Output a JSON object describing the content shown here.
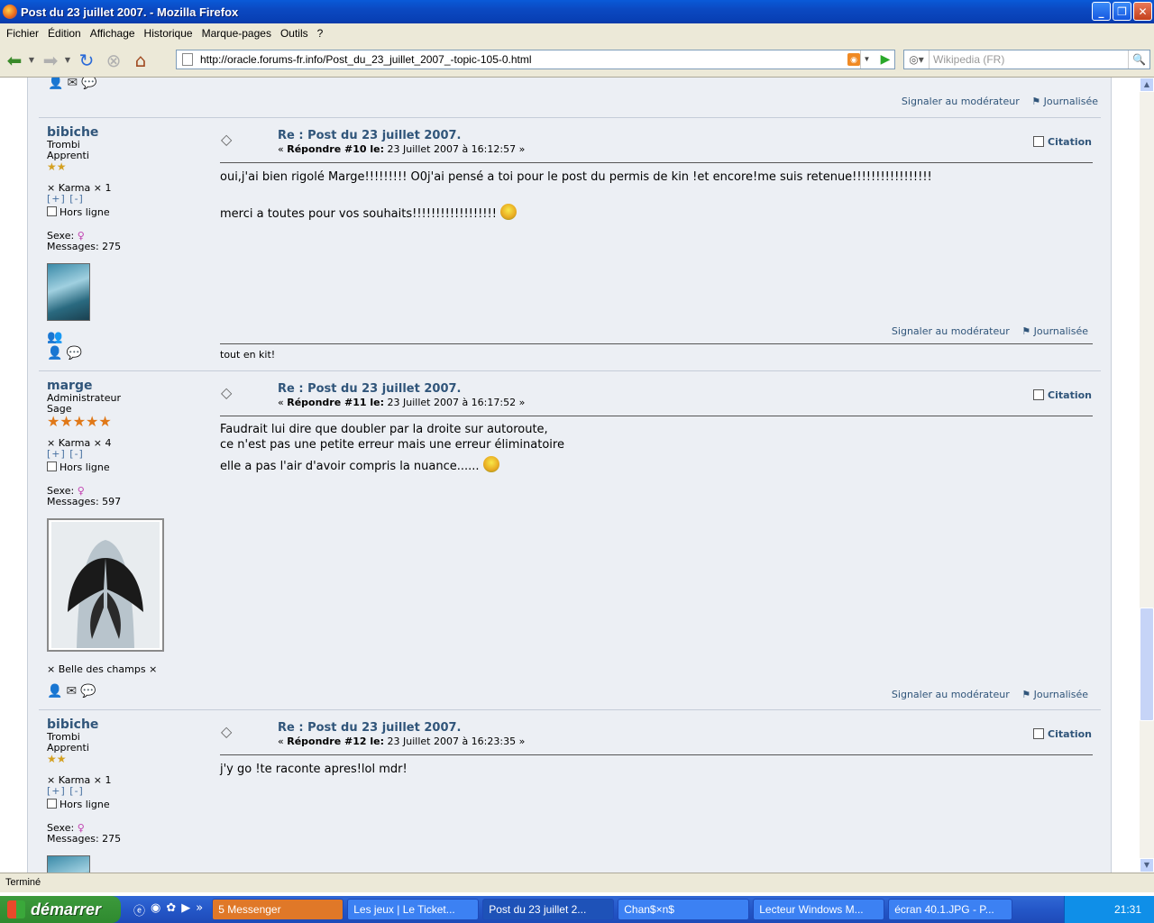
{
  "window": {
    "title": "Post du 23 juillet 2007. - Mozilla Firefox"
  },
  "menu": [
    "Fichier",
    "Édition",
    "Affichage",
    "Historique",
    "Marque-pages",
    "Outils",
    "?"
  ],
  "nav": {
    "url": "http://oracle.forums-fr.info/Post_du_23_juillet_2007_-topic-105-0.html",
    "search_placeholder": "Wikipedia (FR)"
  },
  "common": {
    "report": "Signaler au modérateur",
    "logged": "Journalisée",
    "citation": "Citation",
    "subject": "Re : Post du 23 juillet 2007.",
    "karma_links": "[+] [-]",
    "offline": "Hors ligne"
  },
  "posts": [
    {
      "author": "bibiche",
      "group": "Trombi",
      "rank": "Apprenti",
      "stars": "★★",
      "karma": "× Karma × 1",
      "sex": "Sexe:",
      "messages": "Messages: 275",
      "reply_label": "Répondre #10 le:",
      "date": "23 Juillet 2007 à 16:12:57",
      "lines": [
        "oui,j'ai bien rigolé Marge!!!!!!!!! O0j'ai pensé a toi pour le post du permis de kin !et encore!me suis retenue!!!!!!!!!!!!!!!!!",
        "",
        "merci a toutes pour vos souhaits!!!!!!!!!!!!!!!!!!"
      ],
      "signature": "tout en kit!"
    },
    {
      "author": "marge",
      "group": "Administrateur",
      "rank": "Sage",
      "stars": "★★★★★",
      "karma": "× Karma × 4",
      "sex": "Sexe:",
      "messages": "Messages: 597",
      "reply_label": "Répondre #11 le:",
      "date": "23 Juillet 2007 à 16:17:52",
      "lines": [
        "Faudrait lui dire que doubler par la droite sur autoroute,",
        "ce n'est pas une petite erreur mais une erreur éliminatoire",
        "elle a pas l'air d'avoir compris la nuance......"
      ],
      "personal_text": "× Belle des champs ×"
    },
    {
      "author": "bibiche",
      "group": "Trombi",
      "rank": "Apprenti",
      "stars": "★★",
      "karma": "× Karma × 1",
      "sex": "Sexe:",
      "messages": "Messages: 275",
      "reply_label": "Répondre #12 le:",
      "date": "23 Juillet 2007 à 16:23:35",
      "lines": [
        "j'y go !te raconte apres!lol mdr!"
      ]
    }
  ],
  "status": "Terminé",
  "taskbar": {
    "start": "démarrer",
    "tasks": [
      "5 Messenger",
      "Les jeux | Le Ticket...",
      "Post du 23 juillet 2...",
      "Chan$×n$",
      "Lecteur Windows M...",
      "écran 40.1.JPG - P..."
    ],
    "clock": "21:31"
  },
  "colors": {
    "title_blue": "#0b49c1",
    "link_blue": "#30557a",
    "forum_bg": "#eceff4"
  }
}
